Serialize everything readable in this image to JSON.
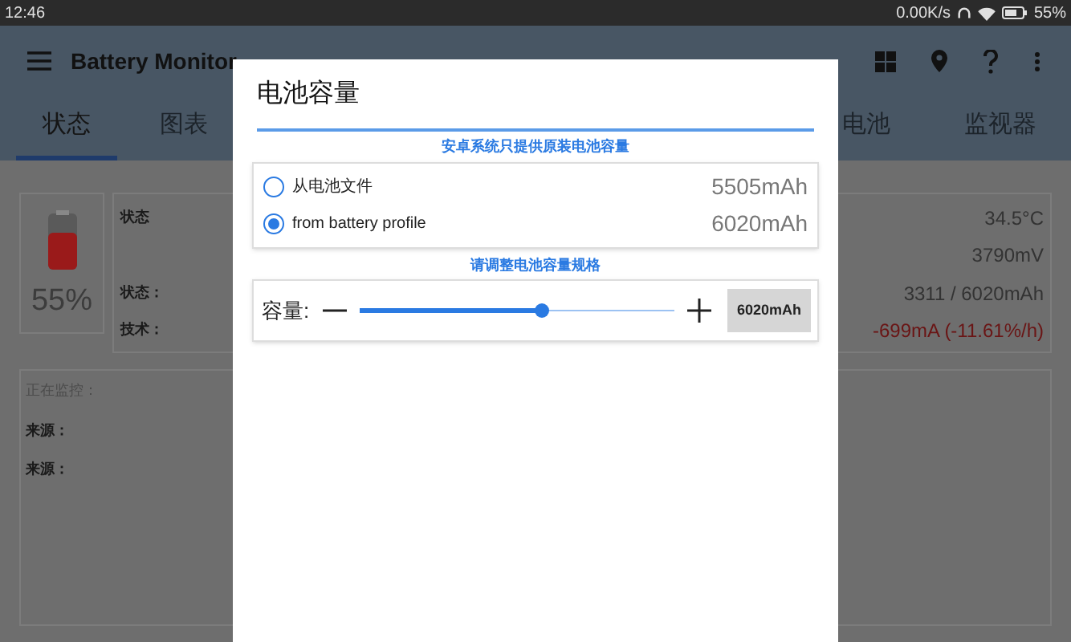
{
  "status_bar": {
    "time": "12:46",
    "speed": "0.00K/s",
    "battery": "55%"
  },
  "app_bar": {
    "title": "Battery Monitor"
  },
  "tabs": [
    {
      "label": "状态",
      "selected": true
    },
    {
      "label": "图表",
      "selected": false
    },
    {
      "label": "电池",
      "selected": false
    },
    {
      "label": "监视器",
      "selected": false
    }
  ],
  "battery_card": {
    "percent": "55%"
  },
  "info_card": {
    "rows": [
      {
        "label": "状态",
        "value": "34.5°C",
        "kind": "normal"
      },
      {
        "label": "",
        "value": "3790mV",
        "kind": "normal"
      },
      {
        "label": "状态：",
        "value": "3311 / 6020mAh",
        "kind": "normal"
      },
      {
        "label": "技术：",
        "value": "-699mA (-11.61%/h)",
        "kind": "alert"
      }
    ]
  },
  "monitor_card": {
    "heading": "正在监控：",
    "rows": [
      "来源：",
      "来源："
    ]
  },
  "dialog": {
    "title": "电池容量",
    "hint_1": "安卓系统只提供原装电池容量",
    "options": [
      {
        "label": "从电池文件",
        "value": "5505mAh",
        "selected": false
      },
      {
        "label": "from battery profile",
        "value": "6020mAh",
        "selected": true
      }
    ],
    "hint_2": "请调整电池容量规格",
    "capacity": {
      "label": "容量:",
      "level": 0.58,
      "reading": "6020mAh"
    }
  }
}
